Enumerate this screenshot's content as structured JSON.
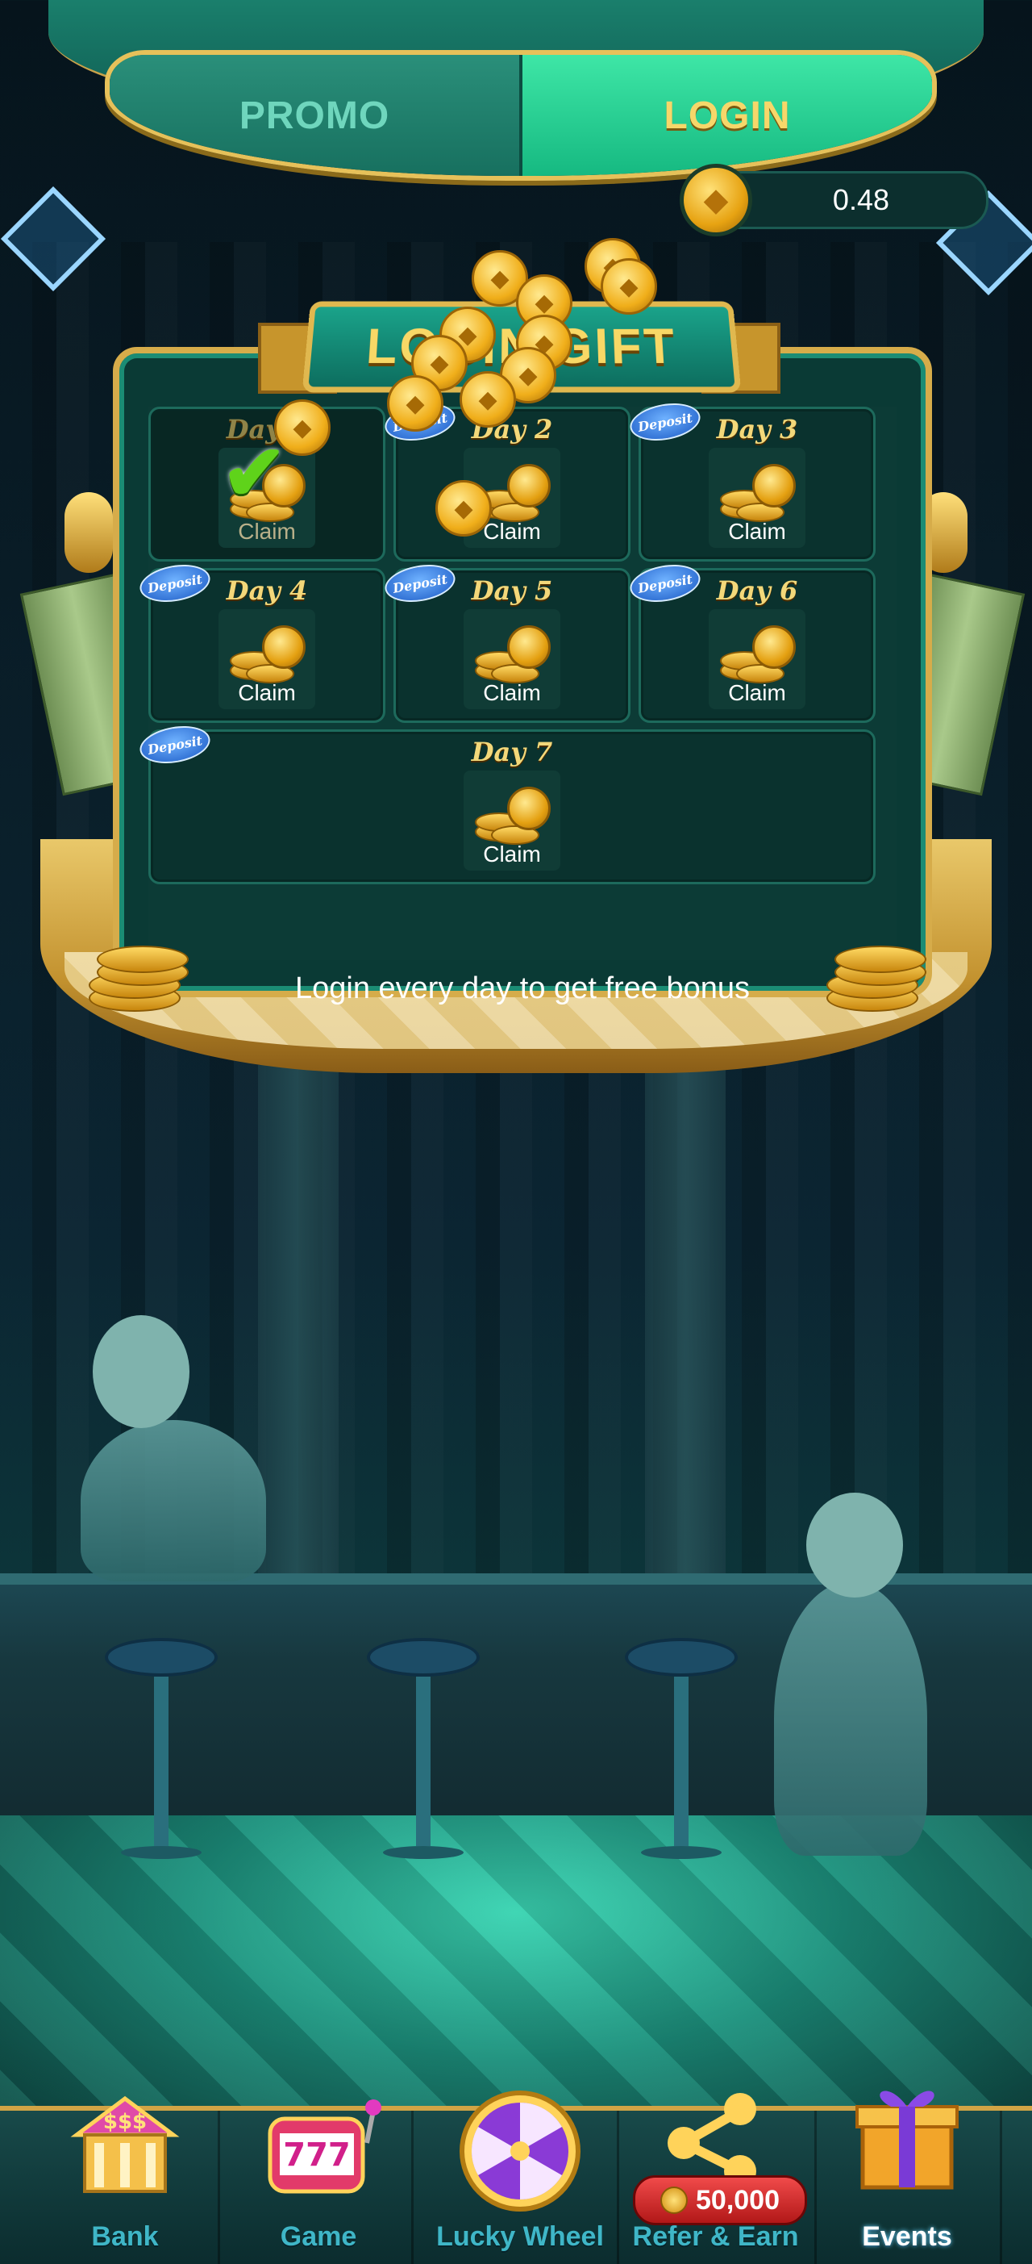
{
  "tabs": {
    "promo": "PROMO",
    "login": "LOGIN"
  },
  "balance": {
    "value": "0.48"
  },
  "gift": {
    "title": "LOGIN GIFT",
    "footer": "Login every day to get free bonus",
    "deposit_badge": "Deposit",
    "days": [
      {
        "label": "Day 1",
        "action": "Claim",
        "claimed": true,
        "deposit": false
      },
      {
        "label": "Day 2",
        "action": "Claim",
        "claimed": false,
        "deposit": true
      },
      {
        "label": "Day 3",
        "action": "Claim",
        "claimed": false,
        "deposit": true
      },
      {
        "label": "Day 4",
        "action": "Claim",
        "claimed": false,
        "deposit": true
      },
      {
        "label": "Day 5",
        "action": "Claim",
        "claimed": false,
        "deposit": true
      },
      {
        "label": "Day 6",
        "action": "Claim",
        "claimed": false,
        "deposit": true
      },
      {
        "label": "Day 7",
        "action": "Claim",
        "claimed": false,
        "deposit": true
      }
    ]
  },
  "nav": {
    "items": [
      {
        "label": "Bank",
        "icon": "bank-icon"
      },
      {
        "label": "Game",
        "icon": "slot-777-icon"
      },
      {
        "label": "Lucky Wheel",
        "icon": "wheel-icon"
      },
      {
        "label": "Refer & Earn",
        "icon": "share-icon",
        "badge": "50,000"
      },
      {
        "label": "Events",
        "icon": "gift-box-icon",
        "active": true
      }
    ]
  },
  "colors": {
    "accent_gold": "#e6c15a",
    "panel_green": "#0a3a35",
    "active_tab": "#16b981"
  }
}
